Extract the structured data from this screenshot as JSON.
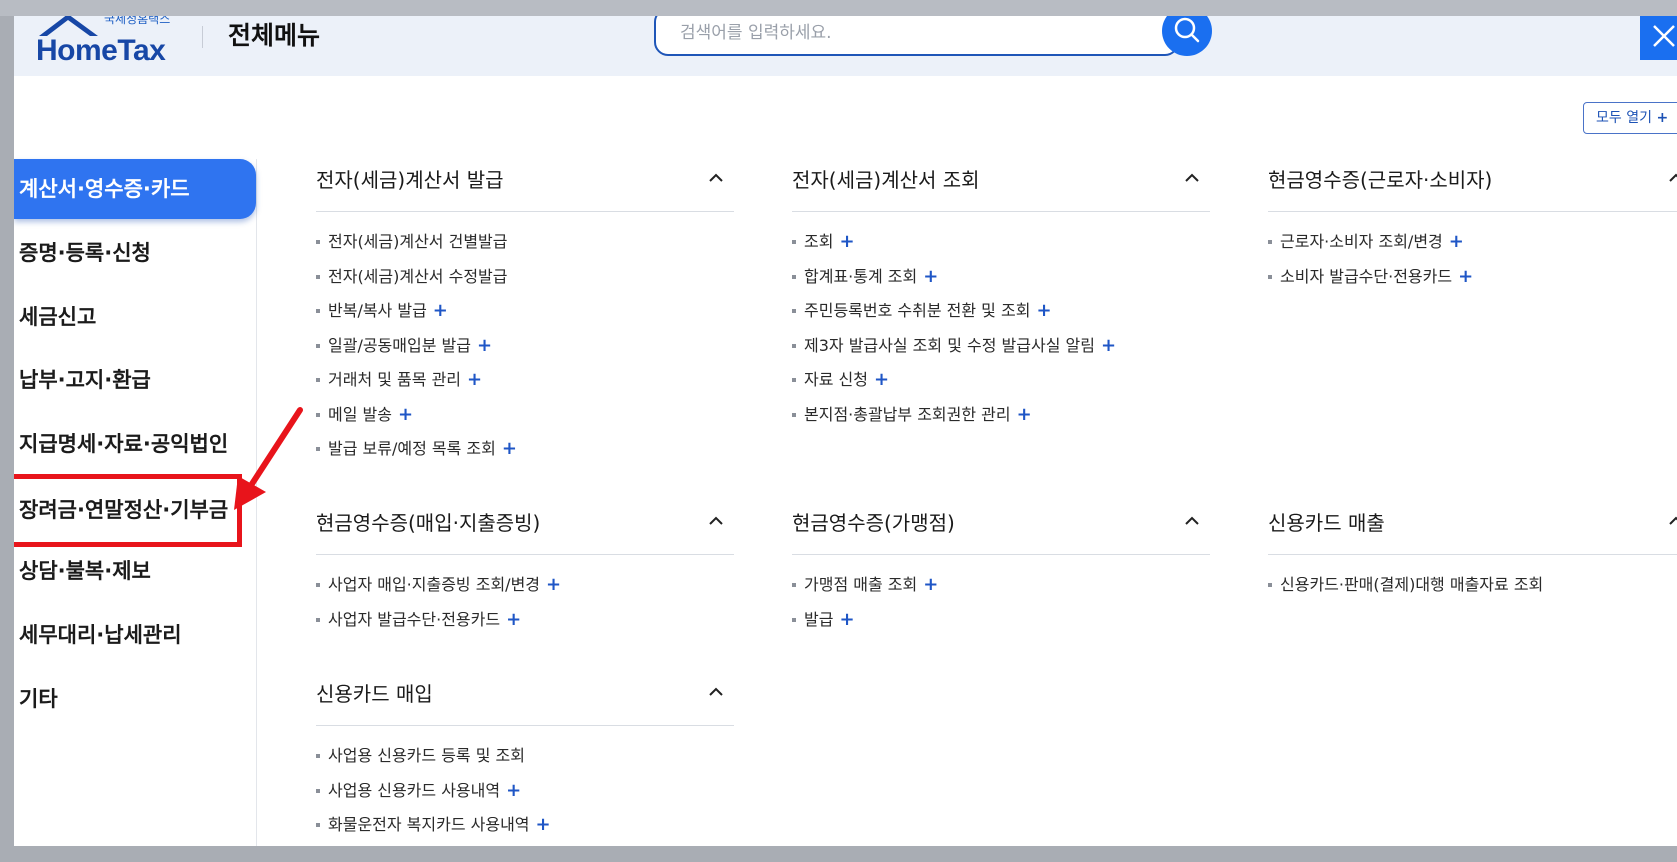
{
  "header": {
    "logo_sub": "국세청홈택스",
    "logo_main": "HomeTax",
    "title": "전체메뉴",
    "search_placeholder": "검색어를 입력하세요."
  },
  "expand_all_label": "모두 열기",
  "expand_all_plus": "+",
  "sidebar": {
    "items": [
      {
        "label": "계산서·영수증·카드",
        "active": true
      },
      {
        "label": "증명·등록·신청"
      },
      {
        "label": "세금신고"
      },
      {
        "label": "납부·고지·환급"
      },
      {
        "label": "지급명세·자료·공익법인"
      },
      {
        "label": "장려금·연말정산·기부금",
        "highlighted": true
      },
      {
        "label": "상담·불복·제보"
      },
      {
        "label": "세무대리·납세관리"
      },
      {
        "label": "기타"
      }
    ]
  },
  "plus_symbol": "+",
  "groups": [
    {
      "title": "전자(세금)계산서 발급",
      "items": [
        {
          "label": "전자(세금)계산서 건별발급",
          "plus": false
        },
        {
          "label": "전자(세금)계산서 수정발급",
          "plus": false
        },
        {
          "label": "반복/복사 발급",
          "plus": true
        },
        {
          "label": "일괄/공동매입분 발급",
          "plus": true
        },
        {
          "label": "거래처 및 품목 관리",
          "plus": true
        },
        {
          "label": "메일 발송",
          "plus": true
        },
        {
          "label": "발급 보류/예정 목록 조회",
          "plus": true
        }
      ]
    },
    {
      "title": "전자(세금)계산서 조회",
      "items": [
        {
          "label": "조회",
          "plus": true
        },
        {
          "label": "합계표·통계 조회",
          "plus": true
        },
        {
          "label": "주민등록번호 수취분 전환 및 조회",
          "plus": true
        },
        {
          "label": "제3자 발급사실 조회 및 수정 발급사실 알림",
          "plus": true
        },
        {
          "label": "자료 신청",
          "plus": true
        },
        {
          "label": "본지점·총괄납부 조회권한 관리",
          "plus": true
        }
      ]
    },
    {
      "title": "현금영수증(근로자·소비자)",
      "items": [
        {
          "label": "근로자·소비자 조회/변경",
          "plus": true
        },
        {
          "label": "소비자 발급수단·전용카드",
          "plus": true
        }
      ]
    },
    {
      "title": "현금영수증(매입·지출증빙)",
      "items": [
        {
          "label": "사업자 매입·지출증빙 조회/변경",
          "plus": true
        },
        {
          "label": "사업자 발급수단·전용카드",
          "plus": true
        }
      ]
    },
    {
      "title": "현금영수증(가맹점)",
      "items": [
        {
          "label": "가맹점 매출 조회",
          "plus": true
        },
        {
          "label": "발급",
          "plus": true
        }
      ]
    },
    {
      "title": "신용카드 매출",
      "items": [
        {
          "label": "신용카드·판매(결제)대행 매출자료 조회",
          "plus": false
        }
      ]
    },
    {
      "title": "신용카드 매입",
      "items": [
        {
          "label": "사업용 신용카드 등록 및 조회",
          "plus": false
        },
        {
          "label": "사업용 신용카드 사용내역",
          "plus": true
        },
        {
          "label": "화물운전자 복지카드 사용내역",
          "plus": true
        }
      ]
    }
  ]
}
